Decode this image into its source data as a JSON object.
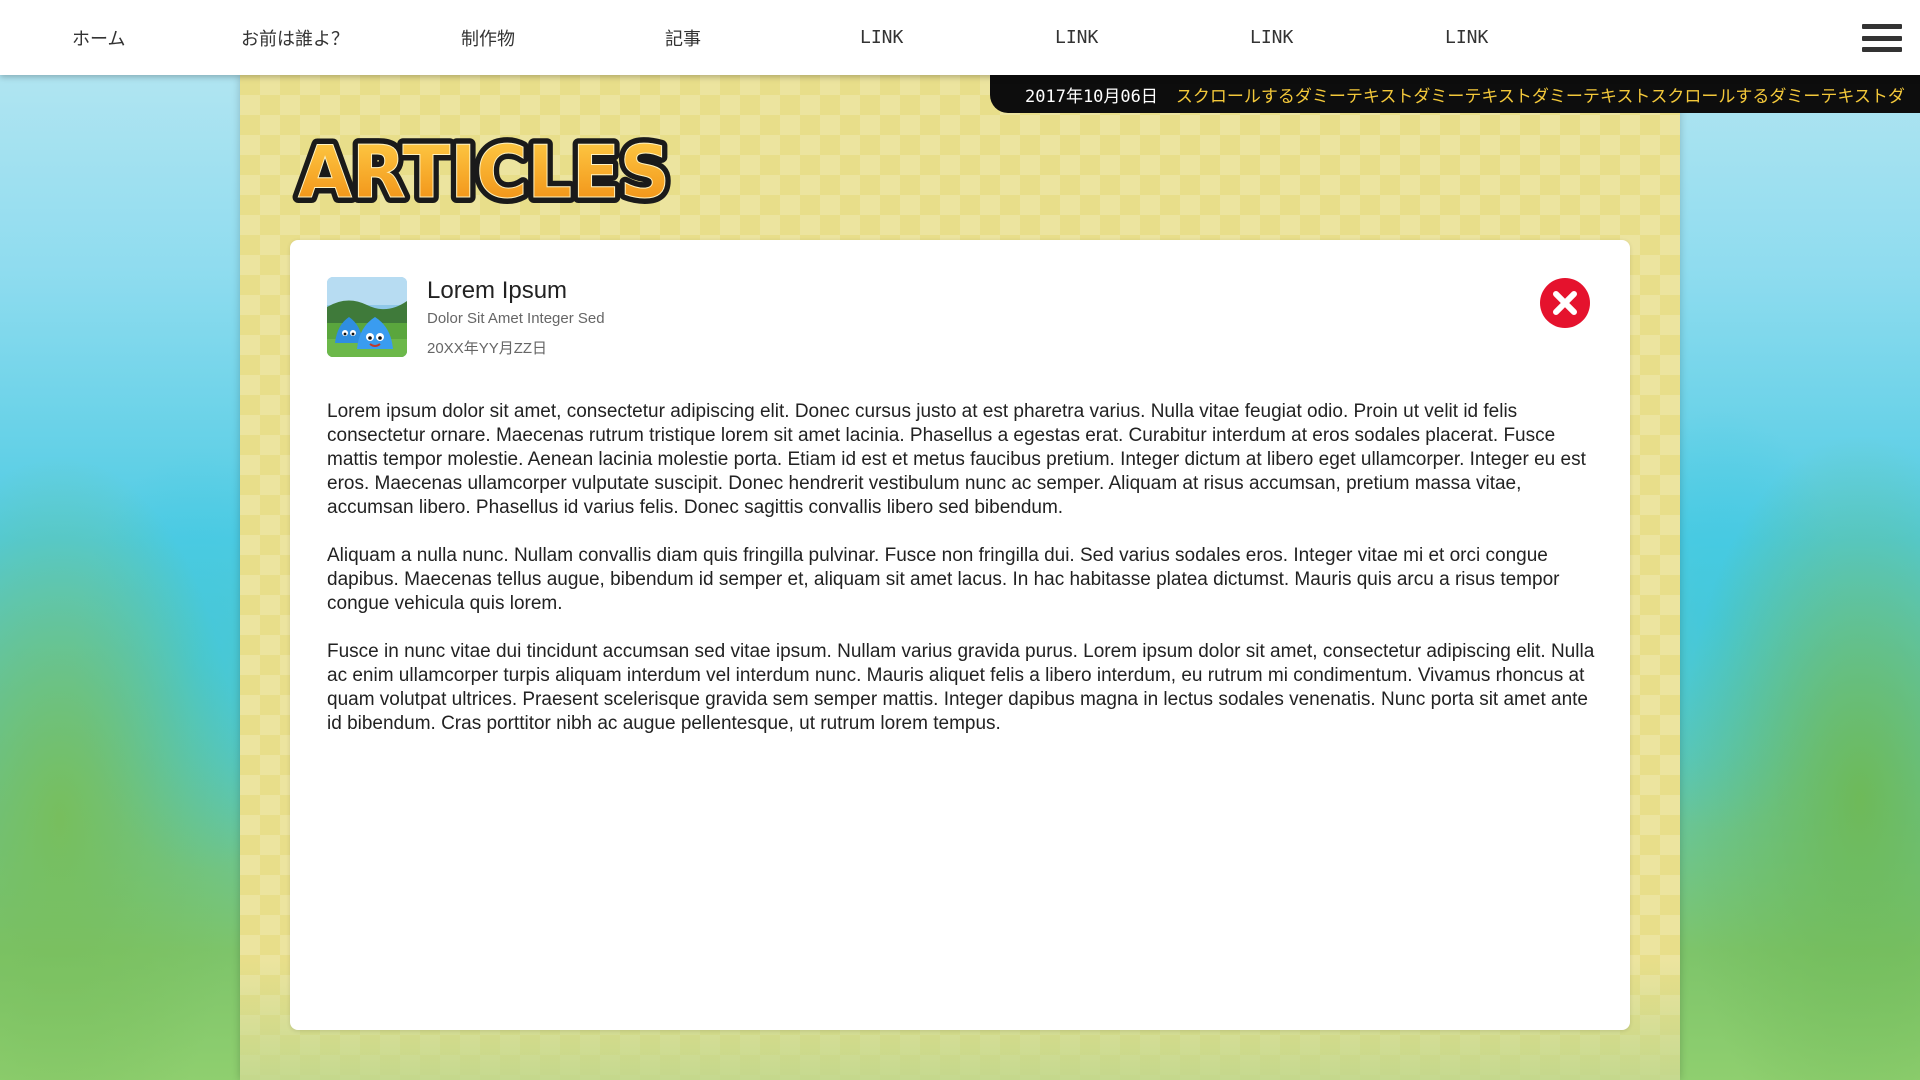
{
  "nav": {
    "items": [
      "ホーム",
      "お前は誰よ？",
      "制作物",
      "記事",
      "LINK",
      "LINK",
      "LINK",
      "LINK"
    ],
    "menu_icon": "hamburger-icon"
  },
  "ticker": {
    "date": "2017年10月06日",
    "text": "スクロールするダミーテキストダミーテキストダミーテキストスクロールするダミーテキストダ"
  },
  "logo": {
    "text": "ARTICLES"
  },
  "article": {
    "title": "Lorem Ipsum",
    "subtitle": "Dolor Sit Amet Integer Sed",
    "date": "20XX年YY月ZZ日",
    "thumbnail_icon": "blue-slime-thumbnail",
    "close_icon": "close-icon",
    "paragraphs": [
      "Lorem ipsum dolor sit amet, consectetur adipiscing elit. Donec cursus justo at est pharetra varius. Nulla vitae feugiat odio. Proin ut velit id felis consectetur ornare. Maecenas rutrum tristique lorem sit amet lacinia. Phasellus a egestas erat. Curabitur interdum at eros sodales placerat. Fusce mattis tempor molestie. Aenean lacinia molestie porta. Etiam id est et metus faucibus pretium. Integer dictum at libero eget ullamcorper. Integer eu est eros. Maecenas ullamcorper vulputate suscipit. Donec hendrerit vestibulum nunc ac semper. Aliquam at risus accumsan, pretium massa vitae, accumsan libero. Phasellus id varius felis. Donec sagittis convallis libero sed bibendum.",
      "Aliquam a nulla nunc. Nullam convallis diam quis fringilla pulvinar. Fusce non fringilla dui. Sed varius sodales eros. Integer vitae mi et orci congue dapibus. Maecenas tellus augue, bibendum id semper et, aliquam sit amet lacus. In hac habitasse platea dictumst. Mauris quis arcu a risus tempor congue vehicula quis lorem.",
      "Fusce in nunc vitae dui tincidunt accumsan sed vitae ipsum. Nullam varius gravida purus. Lorem ipsum dolor sit amet, consectetur adipiscing elit. Nulla ac enim ullamcorper turpis aliquam interdum vel interdum nunc. Mauris aliquet felis a libero interdum, eu rutrum mi condimentum. Vivamus rhoncus at quam volutpat ultrices. Praesent scelerisque gravida sem semper mattis. Integer dapibus magna in lectus sodales venenatis. Nunc porta sit amet ante id bibendum. Cras porttitor nibh ac augue pellentesque, ut rutrum lorem tempus."
    ]
  },
  "colors": {
    "accent_close": "#e5122d",
    "ticker_bg": "#0d0d0d",
    "ticker_text": "#f3c83a",
    "content_bg": "#e8de8a",
    "logo_fill": "#f5a020"
  }
}
